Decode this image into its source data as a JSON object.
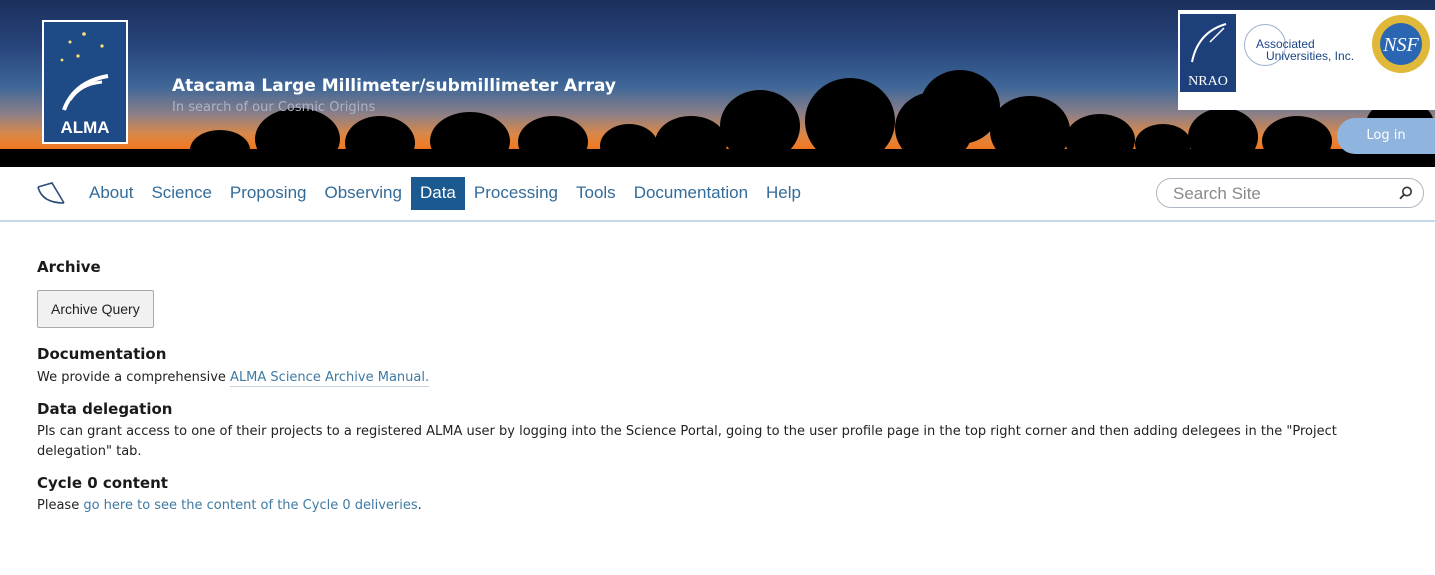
{
  "header": {
    "logo_text": "ALMA",
    "title": "Atacama Large Millimeter/submillimeter Array",
    "subtitle": "In search of our Cosmic Origins",
    "partners": {
      "nrao": "NRAO",
      "aui_line1": "Associated",
      "aui_line2": "Universities, Inc.",
      "nsf": "NSF"
    },
    "login_label": "Log in"
  },
  "nav": {
    "items": [
      {
        "label": "About"
      },
      {
        "label": "Science"
      },
      {
        "label": "Proposing"
      },
      {
        "label": "Observing"
      },
      {
        "label": "Data"
      },
      {
        "label": "Processing"
      },
      {
        "label": "Tools"
      },
      {
        "label": "Documentation"
      },
      {
        "label": "Help"
      }
    ],
    "active": "Data",
    "search_placeholder": "Search Site"
  },
  "content": {
    "archive": {
      "heading": "Archive",
      "button_label": "Archive Query"
    },
    "documentation": {
      "heading": "Documentation",
      "text_before": "We provide a comprehensive ",
      "link": "ALMA Science Archive Manual."
    },
    "delegation": {
      "heading": "Data delegation",
      "text": "PIs can grant access to one of their projects to a registered ALMA user by logging into the Science Portal, going to the user profile page in the top right corner and then adding delegees in the \"Project delegation\" tab."
    },
    "cycle0": {
      "heading": "Cycle 0 content",
      "text_before": "Please ",
      "link": "go here to see the content of the Cycle 0 deliveries",
      "text_after": "."
    }
  },
  "colors": {
    "nav_active_bg": "#1a5a91",
    "link": "#3e7aa3",
    "login_bg": "#8fb4dd"
  }
}
